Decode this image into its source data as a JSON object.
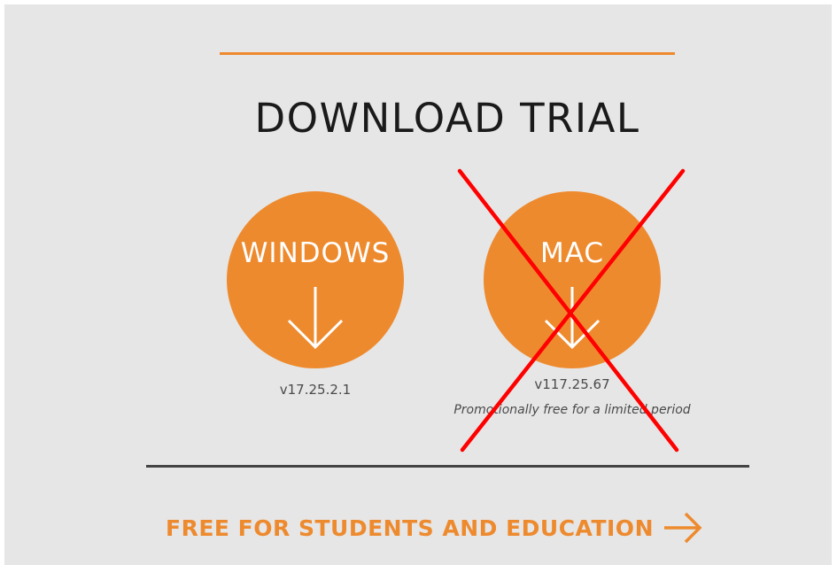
{
  "header": {
    "title": "DOWNLOAD TRIAL"
  },
  "downloads": {
    "windows": {
      "label": "WINDOWS",
      "version": "v17.25.2.1"
    },
    "mac": {
      "label": "MAC",
      "version": "v117.25.67",
      "note": "Promotionally free for a limited period",
      "crossed_out": true
    }
  },
  "footer": {
    "education_link": "FREE FOR STUDENTS AND EDUCATION"
  },
  "icons": {
    "download": "arrow-down-icon",
    "forward": "arrow-right-icon",
    "cross": "red-x-overlay"
  },
  "colors": {
    "accent": "#ee8a2e",
    "background": "#e6e6e6",
    "cross": "#ff0000",
    "rule": "#444444"
  }
}
